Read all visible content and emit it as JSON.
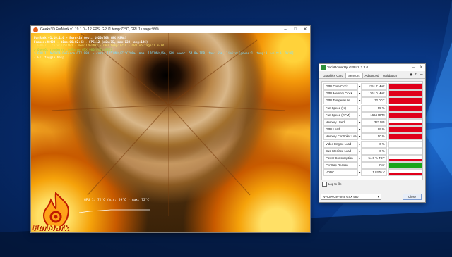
{
  "furmark": {
    "title": "Geeks3D FurMark v1.19.1.0 - 12 FPS, GPU1 temp:72°C, GPU1 usage:99%",
    "overlay_lines": [
      "FurMark v1.19.1.0 - Burn-in test, 1920x768 (8X MSAA)",
      "Frames:28492 - time:00:02:43 - FPS:12 (min:75, max:128, avg:126)",
      "[ GPU-Z ] core:1151MHz - mem:1761MHz - GPU temp:72°C - GPU voltage:1.037V",
      "> OpenGL renderer: GeForce GTX 980/PCIe/SSE2",
      "> GPU 1 (NVIDIA GeForce GTX 980) - core: 1151MHz/72°C/99%, mem: 1761MHz/6%, GPU power: 54.0% TDP, fan: 55%, limits:[power:1, temp:0, volt:0, OV:0]",
      "- F1: toggle help"
    ],
    "graph_label": "GPU 1: 72°C (min: 59°C - max: 72°C)",
    "logo_text": "FurMark"
  },
  "gpuz": {
    "title": "TechPowerUp GPU-Z 2.3.0",
    "tabs": [
      "Graphics Card",
      "Sensors",
      "Advanced",
      "Validation"
    ],
    "active_tab": "Sensors",
    "sensors": [
      {
        "label": "GPU Core Clock",
        "value": "1151.7 MHz",
        "fill": 1.0,
        "color": "#e0001b"
      },
      {
        "label": "GPU Memory Clock",
        "value": "1761.0 MHz",
        "fill": 1.0,
        "color": "#e0001b"
      },
      {
        "label": "GPU Temperature",
        "value": "72.0 °C",
        "fill": 1.0,
        "color": "#e0001b"
      },
      {
        "label": "Fan Speed (%)",
        "value": "55 %",
        "fill": 1.0,
        "color": "#e0001b"
      },
      {
        "label": "Fan Speed (RPM)",
        "value": "1664 RPM",
        "fill": 1.0,
        "color": "#e0001b"
      },
      {
        "label": "Memory Used",
        "value": "323 MB",
        "fill": 1.0,
        "color": "#e0001b",
        "thin": true
      },
      {
        "label": "GPU Load",
        "value": "99 %",
        "fill": 1.0,
        "color": "#e0001b"
      },
      {
        "label": "Memory Controller Load",
        "value": "50 %",
        "fill": 1.0,
        "color": "#e0001b"
      },
      {
        "label": "Video Engine Load",
        "value": "0 %",
        "fill": 0.0,
        "color": "#e0001b"
      },
      {
        "label": "Bus Interface Load",
        "value": "0 %",
        "fill": 0.0,
        "color": "#e0001b"
      },
      {
        "label": "Power Consumption",
        "value": "54.0 % TDP",
        "fill": 1.0,
        "color": "#e0001b",
        "thin": true
      },
      {
        "label": "PerfCap Reason",
        "value": "Pwr",
        "fill": 1.0,
        "color": "#1aa51a"
      },
      {
        "label": "VDDC",
        "value": "1.0370 V",
        "fill": 1.0,
        "color": "#e0001b",
        "thin": true
      }
    ],
    "log_label": "Log to file",
    "gpu_select": "NVIDIA GeForce GTX 980",
    "close_label": "Close"
  }
}
